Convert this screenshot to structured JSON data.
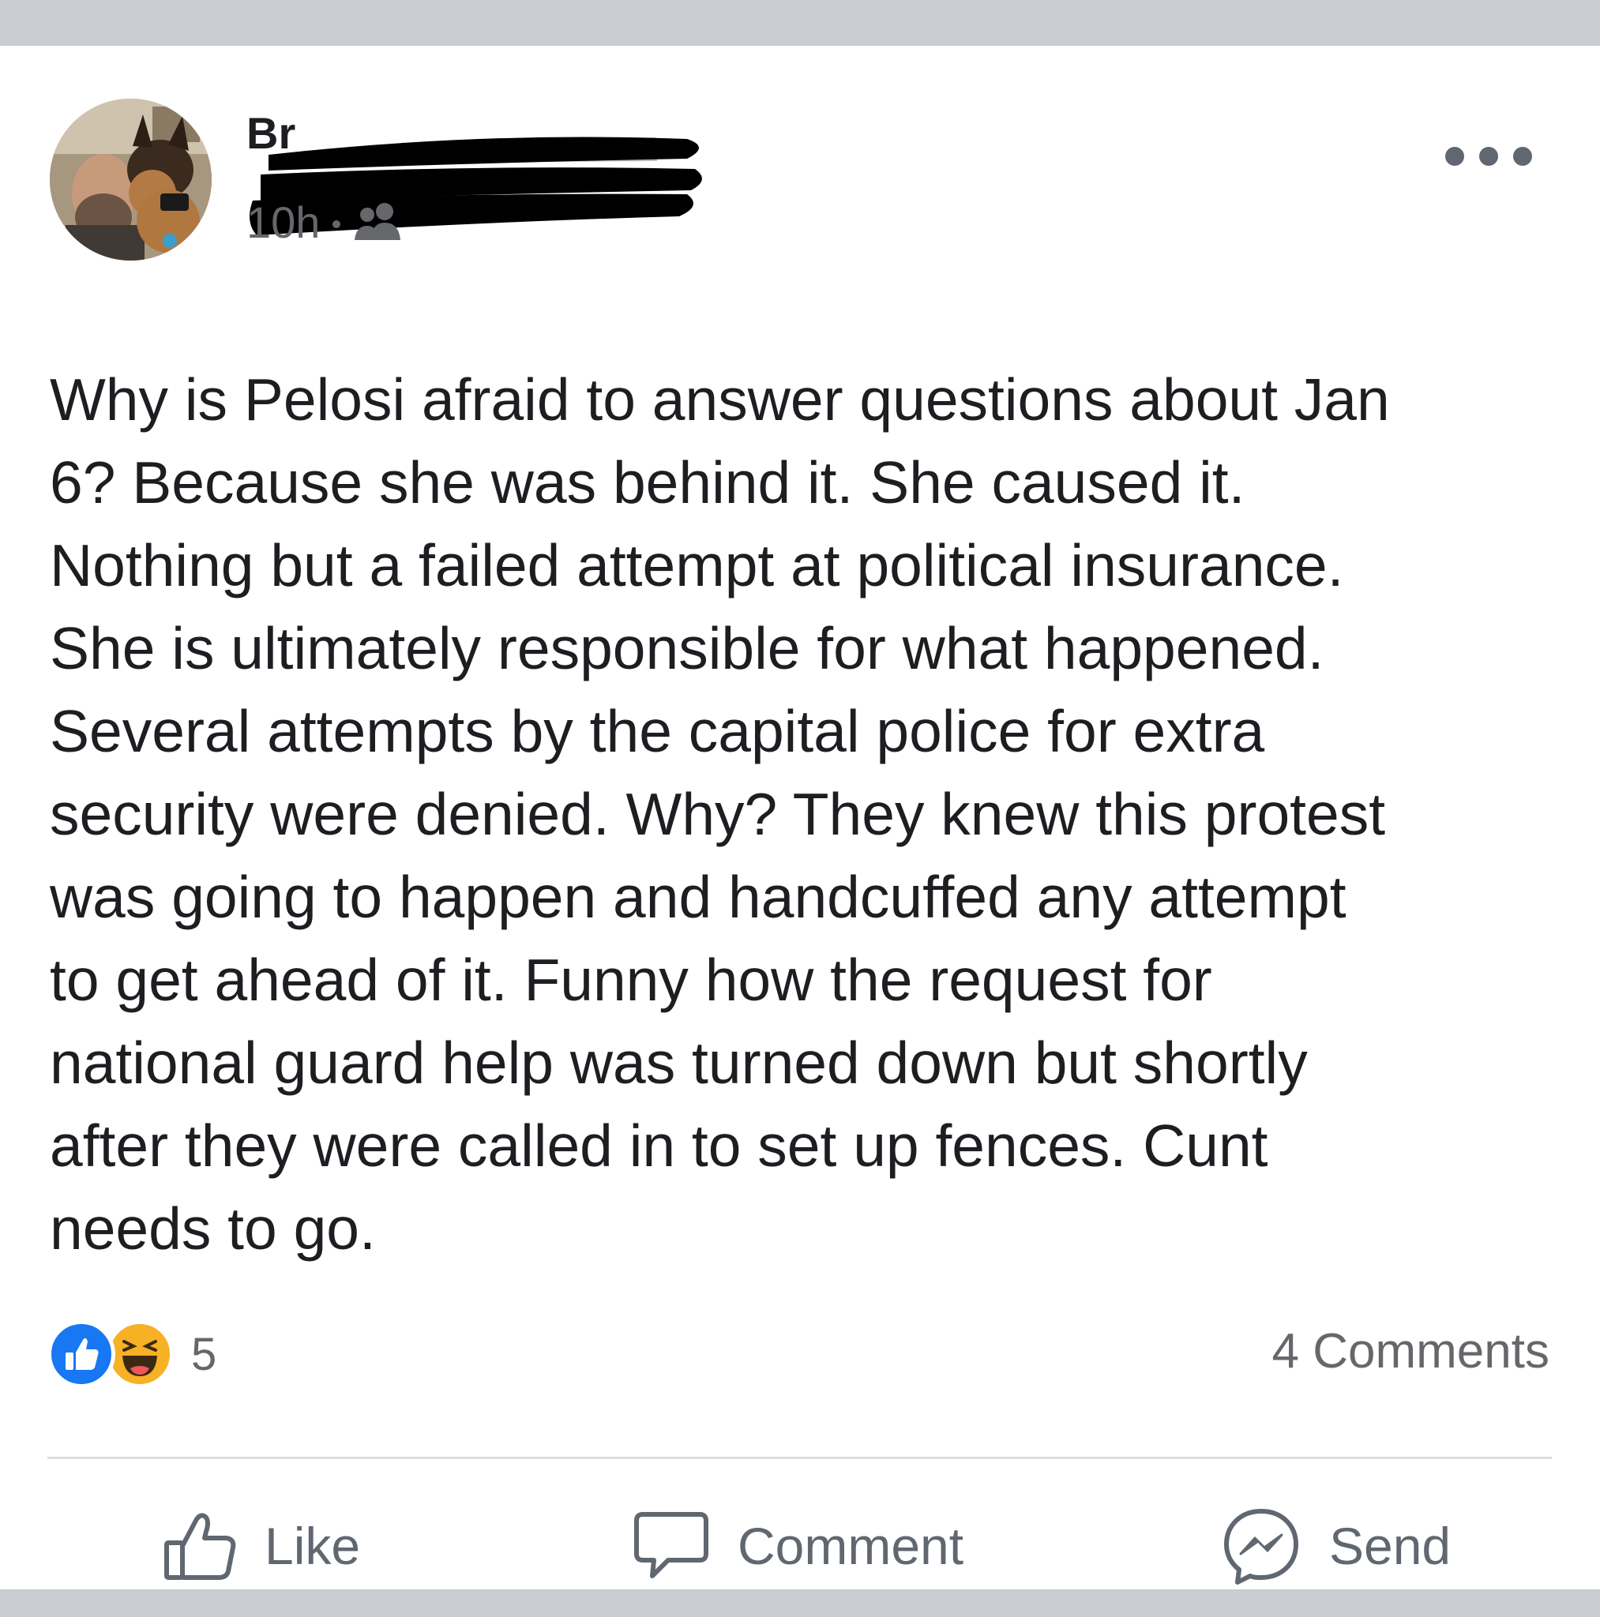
{
  "post": {
    "author_name": "Br",
    "timestamp": "10h",
    "audience_icon": "friends-icon",
    "more_icon": "more-horizontal-icon",
    "text": "Why is Pelosi afraid to answer questions about Jan\n6? Because she was behind it. She caused it.\nNothing but a failed attempt at political insurance.\nShe is ultimately responsible for what happened.\nSeveral attempts by the capital police for extra\nsecurity were denied. Why? They knew this protest\nwas going to happen and handcuffed any attempt\nto get ahead of it. Funny how the request for\nnational guard help was turned down but shortly\nafter they were called in to set up fences. Cunt\nneeds to go."
  },
  "reactions": {
    "icons": [
      "like-reaction-icon",
      "haha-reaction-icon"
    ],
    "count": "5",
    "comments_label": "4 Comments"
  },
  "actions": {
    "like_label": "Like",
    "comment_label": "Comment",
    "send_label": "Send"
  },
  "colors": {
    "page_background": "#c9ccd1",
    "card_background": "#ffffff",
    "text_primary": "#1c1e21",
    "text_secondary": "#65676b",
    "like_blue": "#1877f2",
    "haha_yellow": "#f7b125",
    "redaction": "#000000"
  }
}
